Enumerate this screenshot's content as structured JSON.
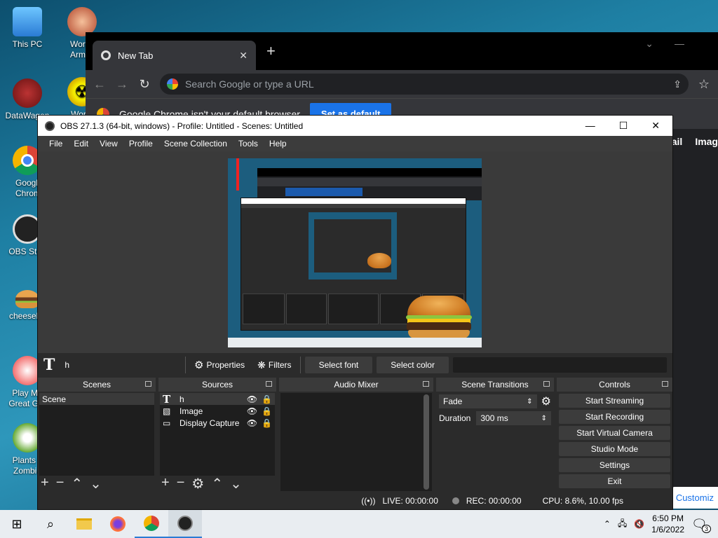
{
  "desktop": {
    "icons": [
      {
        "label": "This PC",
        "icon": "computer-icon"
      },
      {
        "label": "Worm Armage",
        "icon": "worms-game-icon"
      },
      {
        "label": "DataWagon",
        "icon": "datawagon-icon"
      },
      {
        "label": "Worm",
        "icon": "radiation-icon"
      },
      {
        "label": "Google Chrom",
        "icon": "chrome-icon"
      },
      {
        "label": "OBS Stud",
        "icon": "obs-icon"
      },
      {
        "label": "cheesebu",
        "icon": "burger-icon"
      },
      {
        "label": "Play Mo Great Gar",
        "icon": "popcap-icon"
      },
      {
        "label": "Plants v Zombie",
        "icon": "pvz-icon"
      }
    ]
  },
  "chrome": {
    "tab_title": "New Tab",
    "tab_close": "✕",
    "new_tab": "+",
    "address_placeholder": "Search Google or type a URL",
    "infobar_text": "Google Chrome isn't your default browser",
    "set_default_label": "Set as default",
    "gmail_link": "mail",
    "images_link": "Imag",
    "customize_label": "Customiz"
  },
  "obs": {
    "title": "OBS 27.1.3 (64-bit, windows) - Profile: Untitled - Scenes: Untitled",
    "menu": [
      "File",
      "Edit",
      "View",
      "Profile",
      "Scene Collection",
      "Tools",
      "Help"
    ],
    "source_toolbar": {
      "source_name": "h",
      "properties_label": "Properties",
      "filters_label": "Filters",
      "select_font_label": "Select font",
      "select_color_label": "Select color"
    },
    "docks": {
      "scenes": {
        "title": "Scenes",
        "items": [
          "Scene"
        ]
      },
      "sources": {
        "title": "Sources",
        "items": [
          {
            "name": "h",
            "icon": "text-icon"
          },
          {
            "name": "Image",
            "icon": "image-icon"
          },
          {
            "name": "Display Capture",
            "icon": "monitor-icon"
          }
        ]
      },
      "audio_mixer": {
        "title": "Audio Mixer"
      },
      "scene_transitions": {
        "title": "Scene Transitions",
        "transition": "Fade",
        "duration_label": "Duration",
        "duration_value": "300 ms"
      },
      "controls": {
        "title": "Controls",
        "buttons": [
          "Start Streaming",
          "Start Recording",
          "Start Virtual Camera",
          "Studio Mode",
          "Settings",
          "Exit"
        ]
      }
    },
    "status": {
      "live": "LIVE: 00:00:00",
      "rec": "REC: 00:00:00",
      "cpu": "CPU: 8.6%, 10.00 fps"
    }
  },
  "taskbar": {
    "time": "6:50 PM",
    "date": "1/6/2022",
    "notification_count": "3"
  }
}
